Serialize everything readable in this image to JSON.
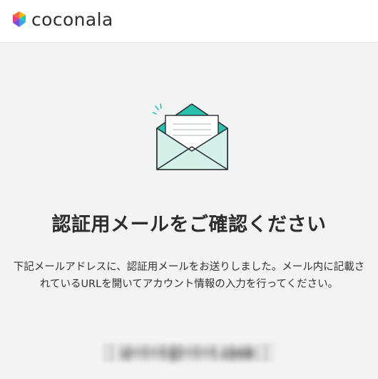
{
  "header": {
    "brand_name": "coconala"
  },
  "illustration": {
    "icon": "open-envelope-with-letter-icon",
    "colors": {
      "flap": "#2bbfae",
      "body": "#d3f0ea",
      "outline": "#2a2f33",
      "letter": "#ffffff"
    }
  },
  "main": {
    "title": "認証用メールをご確認ください",
    "message": "下記メールアドレスに、認証用メールをお送りしました。メール内に記載されているURLを開いてアカウント情報の入力を行ってください。",
    "email": "s••••@••••.com"
  },
  "colors": {
    "page_background": "#f2f3f4",
    "header_background": "#ffffff"
  }
}
